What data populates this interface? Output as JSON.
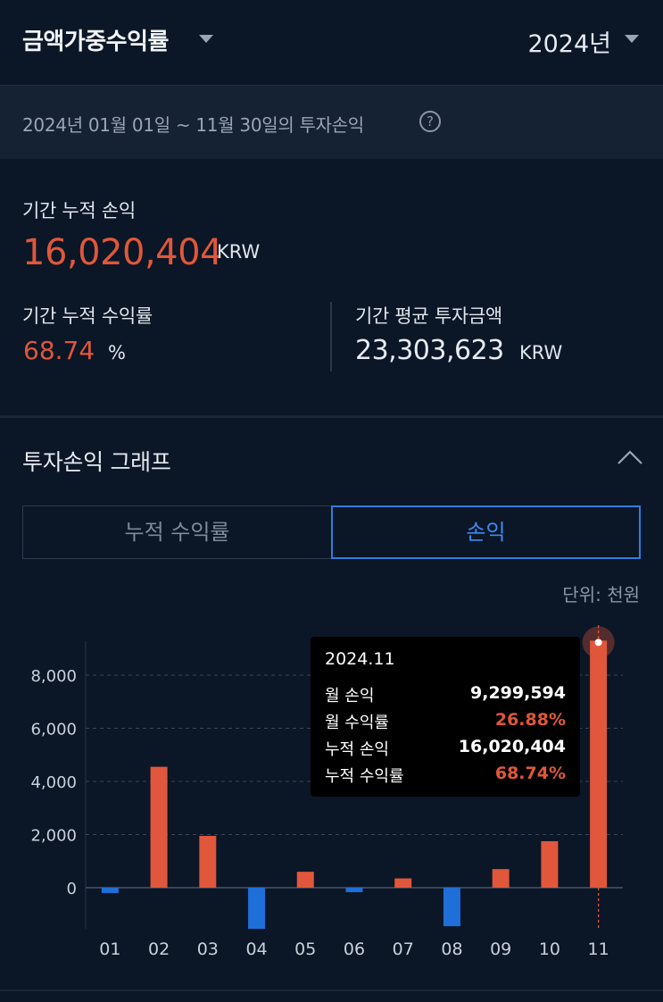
{
  "header": {
    "title": "금액가중수익률",
    "year": "2024년"
  },
  "period": {
    "text": "2024년 01월 01일 ~ 11월 30일의 투자손익",
    "help_icon": "?"
  },
  "summary": {
    "cum_pnl_label": "기간 누적 손익",
    "cum_pnl_value": "16,020,404",
    "cum_pnl_unit": "KRW",
    "cum_rate_label": "기간 누적 수익률",
    "cum_rate_value": "68.74",
    "cum_rate_unit": "%",
    "avg_invest_label": "기간 평균 투자금액",
    "avg_invest_value": "23,303,623",
    "avg_invest_unit": "KRW"
  },
  "graph": {
    "title": "투자손익 그래프",
    "tabs": [
      "누적 수익률",
      "손익"
    ],
    "active_tab": "손익",
    "unit_label": "단위: 천원"
  },
  "tooltip": {
    "date": "2024.11",
    "rows": [
      {
        "label": "월 손익",
        "value": "9,299,594",
        "color": "white"
      },
      {
        "label": "월 수익률",
        "value": "26.88%",
        "color": "red"
      },
      {
        "label": "누적 손익",
        "value": "16,020,404",
        "color": "white"
      },
      {
        "label": "누적 수익률",
        "value": "68.74%",
        "color": "red"
      }
    ]
  },
  "colors": {
    "positive": "#e0573b",
    "negative": "#1f6fd8",
    "background": "#0b1626"
  },
  "chart_data": {
    "type": "bar",
    "categories": [
      "01",
      "02",
      "03",
      "04",
      "05",
      "06",
      "07",
      "08",
      "09",
      "10",
      "11"
    ],
    "values": [
      -200,
      4550,
      1950,
      -1550,
      600,
      -170,
      350,
      -1450,
      700,
      1750,
      9300
    ],
    "yticks": [
      0,
      2000,
      4000,
      6000,
      8000
    ],
    "ytick_labels": [
      "0",
      "2,000",
      "4,000",
      "6,000",
      "8,000"
    ],
    "ylim": [
      -1550,
      9600
    ],
    "highlight_index": 10,
    "grid": true
  }
}
